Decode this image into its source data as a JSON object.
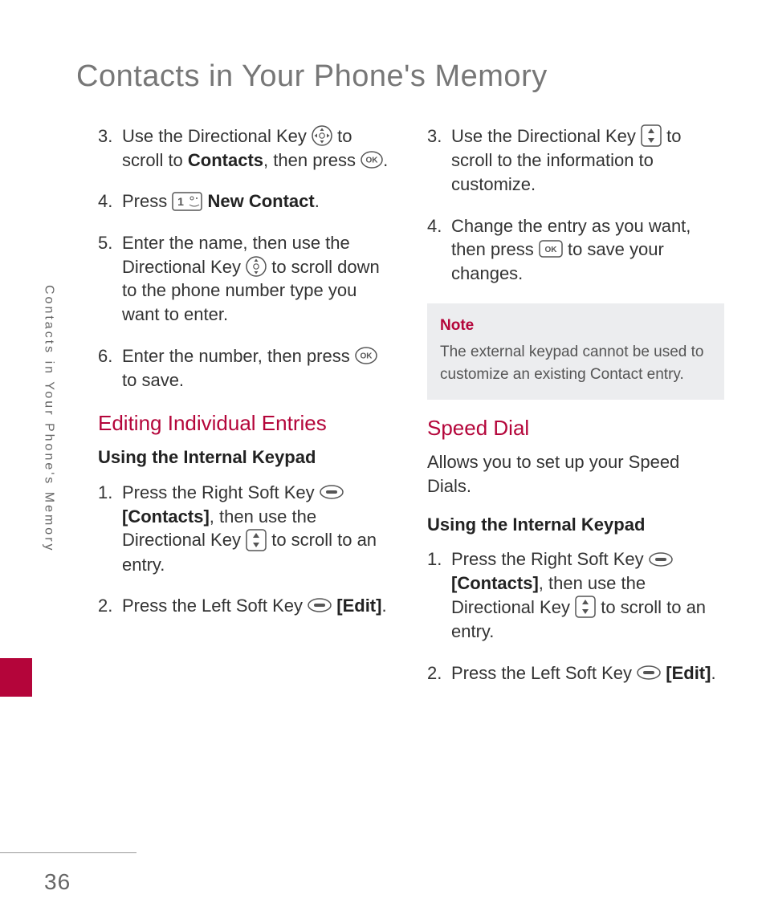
{
  "page": {
    "title": "Contacts in Your Phone's Memory",
    "side_label": "Contacts in Your Phone's Memory",
    "number": "36"
  },
  "col1": {
    "i3": {
      "num": "3.",
      "a": "Use the Directional Key ",
      "b": " to scroll to ",
      "contacts": "Contacts",
      "c": ", then press ",
      "d": "."
    },
    "i4": {
      "num": "4.",
      "a": "Press ",
      "newcontact": " New Contact",
      "b": "."
    },
    "i5": {
      "num": "5.",
      "a": "Enter the name, then use the Directional Key ",
      "b": " to scroll down to the phone number type you want to enter."
    },
    "i6": {
      "num": "6.",
      "a": "Enter the number, then press ",
      "b": " to save."
    },
    "h2": "Editing Individual Entries",
    "h3": "Using the Internal Keypad",
    "e1": {
      "num": "1.",
      "a": "Press the Right Soft Key ",
      "b": " ",
      "contacts": "[Contacts]",
      "c": ", then use the Directional Key ",
      "d": " to scroll to an entry."
    },
    "e2": {
      "num": "2.",
      "a": "Press the Left Soft Key ",
      "b": " ",
      "edit": "[Edit]",
      "c": "."
    }
  },
  "col2": {
    "i3": {
      "num": "3.",
      "a": "Use the Directional Key ",
      "b": " to scroll to the information to customize."
    },
    "i4": {
      "num": "4.",
      "a": "Change the entry as you want, then press ",
      "b": " to save your changes."
    },
    "note": {
      "label": "Note",
      "text": "The external keypad cannot be used to customize an existing Contact entry."
    },
    "h2": "Speed Dial",
    "intro": "Allows you to set up your Speed Dials.",
    "h3": "Using the Internal Keypad",
    "s1": {
      "num": "1.",
      "a": "Press the Right Soft Key ",
      "b": " ",
      "contacts": "[Contacts]",
      "c": ", then use the Directional Key ",
      "d": " to scroll to an entry."
    },
    "s2": {
      "num": "2.",
      "a": "Press the Left Soft Key ",
      "b": " ",
      "edit": "[Edit]",
      "c": "."
    }
  }
}
